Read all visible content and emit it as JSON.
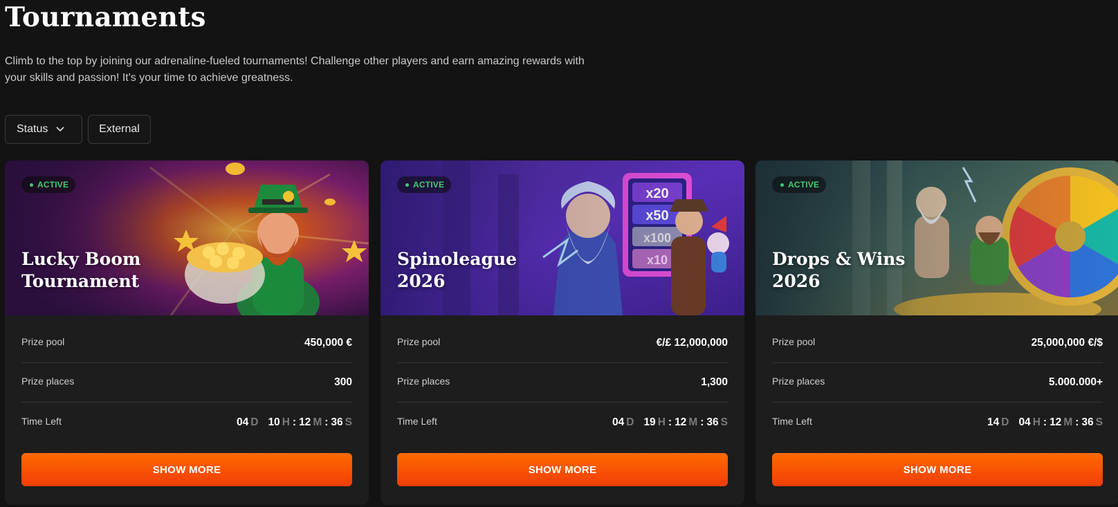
{
  "page": {
    "title": "Tournaments",
    "intro": "Climb to the top by joining our adrenaline-fueled tournaments! Challenge other players and earn amazing rewards with your skills and passion! It's your time to achieve greatness."
  },
  "filters": {
    "status_label": "Status",
    "status_icon": "chevron-down-icon",
    "external_label": "External"
  },
  "labels": {
    "prize_pool": "Prize pool",
    "prize_places": "Prize places",
    "time_left": "Time Left",
    "show_more": "SHOW MORE",
    "unit_d": "D",
    "unit_h": "H",
    "unit_m": "M",
    "unit_s": "S",
    "sep": ":"
  },
  "colors": {
    "accent_start": "#ff6a00",
    "accent_end": "#f23d07",
    "active_green": "#3ecf6e",
    "background": "#131313",
    "card": "#1d1d1d"
  },
  "tournaments": [
    {
      "status": "ACTIVE",
      "title_line1": "Lucky Boom",
      "title_line2": "Tournament",
      "prize_pool": "450,000 €",
      "prize_places": "300",
      "time": {
        "d": "04",
        "h": "10",
        "m": "12",
        "s": "36"
      },
      "banner_theme": "leprechaun-gold-pot"
    },
    {
      "status": "ACTIVE",
      "title_line1": "Spinoleague",
      "title_line2": "2026",
      "prize_pool": "€/£ 12,000,000",
      "prize_places": "1,300",
      "time": {
        "d": "04",
        "h": "19",
        "m": "12",
        "s": "36"
      },
      "banner_theme": "zeus-multipliers",
      "multipliers": [
        "x20",
        "x50",
        "x100",
        "x10"
      ]
    },
    {
      "status": "ACTIVE",
      "title_line1": "Drops & Wins",
      "title_line2": "2026",
      "prize_pool": "25,000,000 €/$",
      "prize_places": "5.000.000+",
      "time": {
        "d": "14",
        "h": "04",
        "m": "12",
        "s": "36"
      },
      "banner_theme": "prize-wheel"
    }
  ]
}
